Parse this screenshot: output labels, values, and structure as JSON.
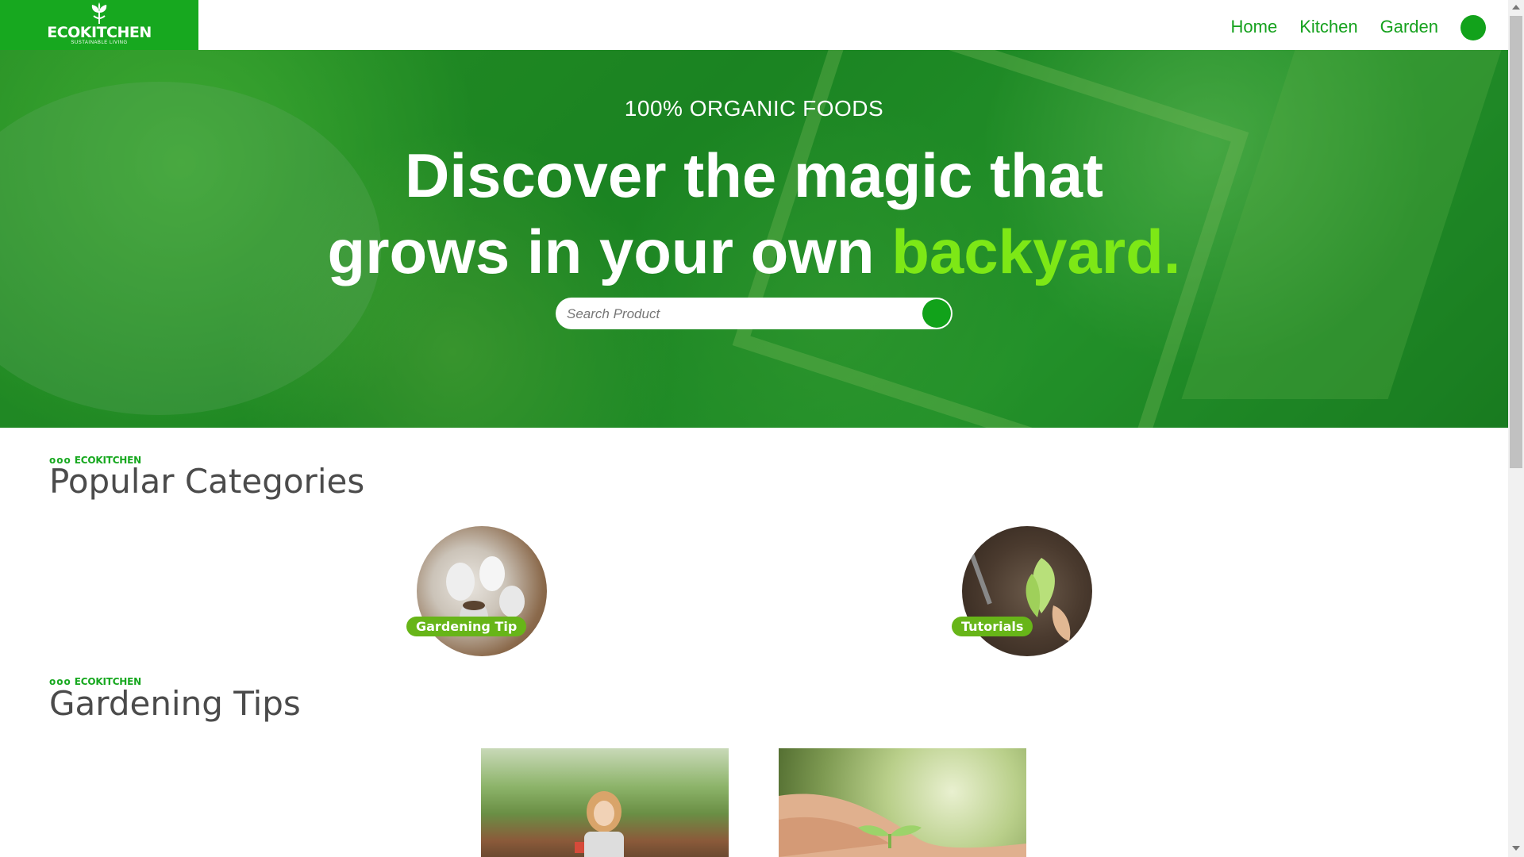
{
  "header": {
    "logo_title": "ECOKITCHEN",
    "logo_subtitle": "SUSTAINABLE LIVING",
    "nav": [
      {
        "label": "Home"
      },
      {
        "label": "Kitchen"
      },
      {
        "label": "Garden"
      }
    ]
  },
  "hero": {
    "eyebrow": "100% ORGANIC FOODS",
    "headline_line1": "Discover the magic that",
    "headline_line2_pre": "grows in your own ",
    "headline_accent": "backyard.",
    "search_placeholder": "Search Product"
  },
  "sections": {
    "categories": {
      "tag": "ECOKITCHEN",
      "title": "Popular Categories"
    },
    "tips": {
      "tag": "ECOKITCHEN",
      "title": "Gardening Tips"
    }
  },
  "categories": [
    {
      "label": "Gardening Tip"
    },
    {
      "label": "Tutorials"
    }
  ],
  "colors": {
    "brand_green": "#17a81f",
    "accent_lime": "#7de816",
    "pill_green": "#67b518",
    "heading_gray": "#4b4b4b"
  },
  "icons": [
    "leaf-logo-icon",
    "search-button-icon",
    "user-avatar-icon"
  ]
}
